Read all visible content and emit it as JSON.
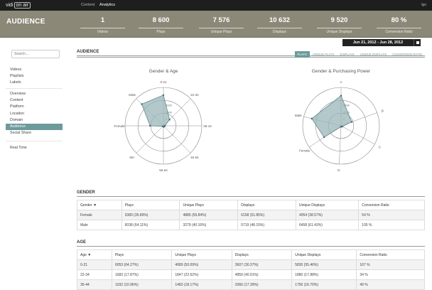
{
  "topbar": {
    "logo_left": "vidi",
    "logo_right": "on air",
    "nav": [
      "Content",
      "Analytics"
    ],
    "logout": "lgo"
  },
  "hero": {
    "title": "AUDIENCE",
    "stats": [
      {
        "value": "1",
        "label": "Videos"
      },
      {
        "value": "8 600",
        "label": "Plays"
      },
      {
        "value": "7 576",
        "label": "Unique Plays"
      },
      {
        "value": "10 632",
        "label": "Displays"
      },
      {
        "value": "9 520",
        "label": "Unique Displays"
      },
      {
        "value": "80 %",
        "label": "Conversion Ratio"
      }
    ]
  },
  "date_range": "Jun 21, 2012 - Jun 28, 2012",
  "sidebar": {
    "search_placeholder": "Search...",
    "group1": [
      "Videos",
      "Playlists",
      "Labels"
    ],
    "group2": [
      "Overview",
      "Content",
      "Platform",
      "Location",
      "Domain",
      "Audience",
      "Social Share"
    ],
    "group3": [
      "Real Time"
    ]
  },
  "audience": {
    "title": "AUDIENCE",
    "tabs": [
      "Plays",
      "Unique Plays",
      "Displays",
      "Unique Displays",
      "Conversion Ratio"
    ],
    "chart1_title": "Gender & Age",
    "chart2_title": "Gender & Purchasing Power",
    "chart1_axes": [
      "0-21",
      "22-34",
      "35-44",
      "45-54",
      "55-64",
      "65+",
      "Female",
      "Male"
    ],
    "chart1_ticks": [
      "5000",
      "2500",
      "0"
    ],
    "chart2_axes": [
      "A",
      "B",
      "C",
      "D",
      "Female",
      "Male"
    ],
    "chart2_ticks": [
      "5000",
      "2500",
      "0"
    ]
  },
  "chart_data": [
    {
      "type": "radar",
      "title": "Gender & Age",
      "axes": [
        "0-21",
        "22-34",
        "35-44",
        "45-54",
        "55-64",
        "65+",
        "Female",
        "Male"
      ],
      "series": [
        {
          "values": [
            6000,
            1700,
            300,
            200,
            200,
            150,
            2600,
            6000
          ]
        }
      ],
      "max": 7500
    },
    {
      "type": "radar",
      "title": "Gender & Purchasing Power",
      "axes": [
        "A",
        "B",
        "C",
        "D",
        "Female",
        "Male"
      ],
      "series": [
        {
          "values": [
            5900,
            2200,
            300,
            200,
            4000,
            5900
          ]
        }
      ],
      "max": 7500
    }
  ],
  "gender": {
    "title": "GENDER",
    "columns": [
      "Gender",
      "Plays",
      "Unique Plays",
      "Displays",
      "Unique Displays",
      "Conversion Ratio"
    ],
    "rows": [
      [
        "Female",
        "3380 (35.89%)",
        "4885 (59.84%)",
        "6158 (51.85%)",
        "4054 (38.57%)",
        "54 %"
      ],
      [
        "Male",
        "6038 (64.11%)",
        "3279 (40.16%)",
        "5719 (48.15%)",
        "6458 (61.43%)",
        "105 %"
      ]
    ]
  },
  "age": {
    "title": "AGE",
    "columns": [
      "Age",
      "Plays",
      "Unique Plays",
      "Displays",
      "Unique Displays",
      "Conversion Ratio"
    ],
    "rows": [
      [
        "0-21",
        "6053 (64.27%)",
        "4089 (50.09%)",
        "3607 (30.37%)",
        "5830 (55.46%)",
        "167 %"
      ],
      [
        "22-34",
        "1683 (17.87%)",
        "1847 (22.62%)",
        "4859 (40.91%)",
        "1880 (17.88%)",
        "34 %"
      ],
      [
        "35-44",
        "1032 (10.96%)",
        "1483 (18.17%)",
        "2066 (17.39%)",
        "1756 (16.70%)",
        "49 %"
      ]
    ]
  }
}
